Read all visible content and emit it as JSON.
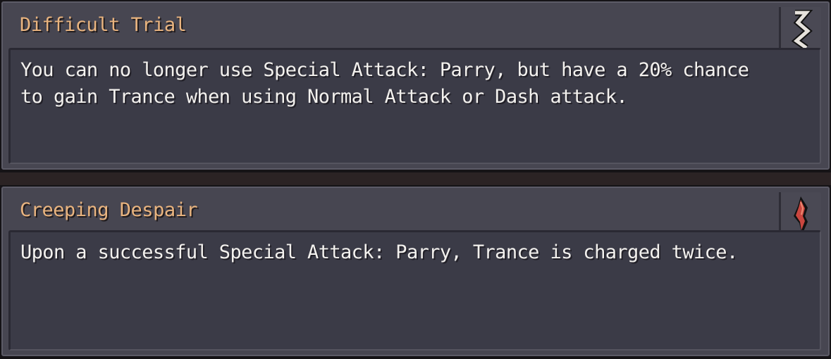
{
  "cards": [
    {
      "title": "Difficult Trial",
      "description": "You can no longer use Special Attack: Parry, but have a 20% chance to gain Trance when using Normal Attack or Dash attack.",
      "icon": "zigzag-rune-icon",
      "icon_color": "#e6e2dc"
    },
    {
      "title": "Creeping Despair",
      "description": "Upon a successful Special Attack: Parry, Trance is charged twice.",
      "icon": "red-spike-icon",
      "icon_color": "#c9463f"
    }
  ],
  "colors": {
    "title_text": "#e9b47f",
    "body_text": "#f3f1ee",
    "panel": "#474651",
    "inner_box": "#3b3b47"
  }
}
